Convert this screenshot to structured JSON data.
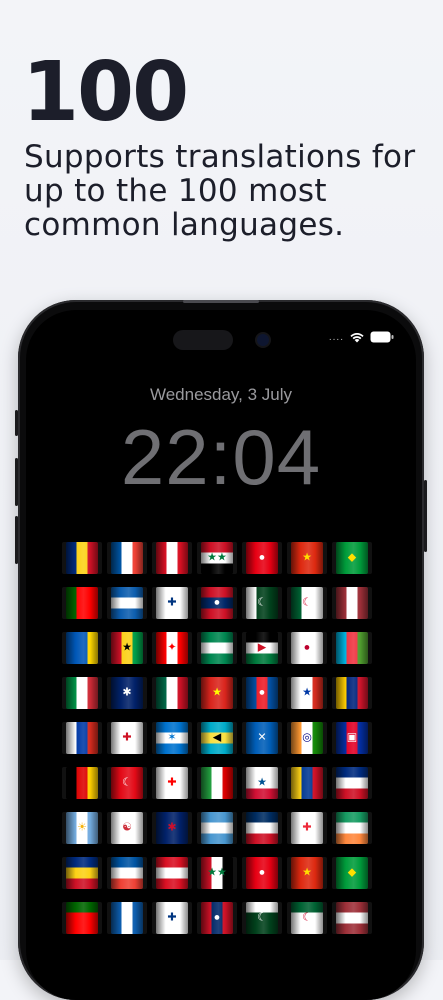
{
  "headline": "100",
  "subline": "Supports translations for up to the 100 most common languages.",
  "lockscreen": {
    "date": "Wednesday, 3 July",
    "time": "22:04",
    "status_dots": "....",
    "icons": [
      "wifi-icon",
      "battery-icon"
    ]
  },
  "flags": [
    {
      "name": "flag-romania",
      "colors": [
        "#002b7f",
        "#fcd116",
        "#ce1126"
      ],
      "dir": "v"
    },
    {
      "name": "flag-france",
      "colors": [
        "#0055a4",
        "#ffffff",
        "#ef4135"
      ],
      "dir": "v"
    },
    {
      "name": "flag-peru",
      "colors": [
        "#d91023",
        "#ffffff",
        "#d91023"
      ],
      "dir": "v"
    },
    {
      "name": "flag-syria",
      "colors": [
        "#ce1126",
        "#ffffff",
        "#000000"
      ],
      "dir": "h",
      "emb": "★★",
      "embColor": "#007a3d"
    },
    {
      "name": "flag-tunisia",
      "colors": [
        "#e70013",
        "#e70013",
        "#e70013"
      ],
      "dir": "h",
      "emb": "●",
      "embColor": "#ffffff"
    },
    {
      "name": "flag-china",
      "colors": [
        "#de2910",
        "#de2910",
        "#de2910"
      ],
      "dir": "h",
      "emb": "★",
      "embColor": "#ffde00"
    },
    {
      "name": "flag-brazil",
      "colors": [
        "#009c3b",
        "#009c3b",
        "#009c3b"
      ],
      "dir": "h",
      "emb": "◆",
      "embColor": "#ffdf00"
    },
    {
      "name": "flag-portugal",
      "colors": [
        "#006600",
        "#ff0000",
        "#ff0000"
      ],
      "dir": "v"
    },
    {
      "name": "flag-greece",
      "colors": [
        "#0d5eaf",
        "#ffffff",
        "#0d5eaf"
      ],
      "dir": "h",
      "emb": "✚",
      "embColor": "#ffffff"
    },
    {
      "name": "flag-finland",
      "colors": [
        "#ffffff",
        "#ffffff",
        "#ffffff"
      ],
      "dir": "h",
      "emb": "✚",
      "embColor": "#003580"
    },
    {
      "name": "flag-laos",
      "colors": [
        "#ce1126",
        "#002868",
        "#ce1126"
      ],
      "dir": "h",
      "emb": "●",
      "embColor": "#ffffff"
    },
    {
      "name": "flag-pakistan",
      "colors": [
        "#ffffff",
        "#01411c",
        "#01411c"
      ],
      "dir": "v",
      "emb": "☾",
      "embColor": "#ffffff"
    },
    {
      "name": "flag-algeria",
      "colors": [
        "#006233",
        "#ffffff",
        "#ffffff"
      ],
      "dir": "v",
      "emb": "☾",
      "embColor": "#d21034"
    },
    {
      "name": "flag-latvia",
      "colors": [
        "#9e3039",
        "#ffffff",
        "#9e3039"
      ],
      "dir": "v"
    },
    {
      "name": "flag-ukraine",
      "colors": [
        "#0057b7",
        "#0057b7",
        "#ffd700"
      ],
      "dir": "v"
    },
    {
      "name": "flag-guinea-bissau",
      "colors": [
        "#ce1126",
        "#fcd116",
        "#009e49"
      ],
      "dir": "v",
      "emb": "★",
      "embColor": "#000000"
    },
    {
      "name": "flag-canada",
      "colors": [
        "#ff0000",
        "#ffffff",
        "#ff0000"
      ],
      "dir": "v",
      "emb": "✦",
      "embColor": "#ff0000"
    },
    {
      "name": "flag-nigeria",
      "colors": [
        "#008751",
        "#ffffff",
        "#008751"
      ],
      "dir": "h"
    },
    {
      "name": "flag-jordan",
      "colors": [
        "#000000",
        "#ffffff",
        "#007a3d"
      ],
      "dir": "h",
      "emb": "▶",
      "embColor": "#ce1126"
    },
    {
      "name": "flag-japan",
      "colors": [
        "#ffffff",
        "#ffffff",
        "#ffffff"
      ],
      "dir": "h",
      "emb": "●",
      "embColor": "#bc002d"
    },
    {
      "name": "flag-azerbaijan",
      "colors": [
        "#00b5e2",
        "#ef3340",
        "#509e2f"
      ],
      "dir": "v"
    },
    {
      "name": "flag-italy",
      "colors": [
        "#009246",
        "#ffffff",
        "#ce2b37"
      ],
      "dir": "v"
    },
    {
      "name": "flag-australia",
      "colors": [
        "#012169",
        "#012169",
        "#012169"
      ],
      "dir": "h",
      "emb": "✱",
      "embColor": "#ffffff"
    },
    {
      "name": "flag-mexico",
      "colors": [
        "#006847",
        "#ffffff",
        "#ce1126"
      ],
      "dir": "v"
    },
    {
      "name": "flag-vietnam",
      "colors": [
        "#da251d",
        "#da251d",
        "#da251d"
      ],
      "dir": "h",
      "emb": "★",
      "embColor": "#ffff00"
    },
    {
      "name": "flag-north-korea",
      "colors": [
        "#024fa2",
        "#ed1c27",
        "#024fa2"
      ],
      "dir": "v",
      "emb": "●",
      "embColor": "#ffffff"
    },
    {
      "name": "flag-chile",
      "colors": [
        "#ffffff",
        "#ffffff",
        "#d52b1e"
      ],
      "dir": "v",
      "emb": "★",
      "embColor": "#0039a6"
    },
    {
      "name": "flag-venezuela",
      "colors": [
        "#ffcc00",
        "#00247d",
        "#cf142b"
      ],
      "dir": "v"
    },
    {
      "name": "flag-russia",
      "colors": [
        "#ffffff",
        "#0039a6",
        "#d52b1e"
      ],
      "dir": "v"
    },
    {
      "name": "flag-england",
      "colors": [
        "#ffffff",
        "#ffffff",
        "#ffffff"
      ],
      "dir": "h",
      "emb": "✚",
      "embColor": "#ce1124"
    },
    {
      "name": "flag-honduras",
      "colors": [
        "#0073cf",
        "#ffffff",
        "#0073cf"
      ],
      "dir": "h",
      "emb": "✶",
      "embColor": "#0073cf"
    },
    {
      "name": "flag-bahamas",
      "colors": [
        "#00abc9",
        "#fae042",
        "#00abc9"
      ],
      "dir": "h",
      "emb": "◀",
      "embColor": "#000000"
    },
    {
      "name": "flag-scotland",
      "colors": [
        "#005eb8",
        "#005eb8",
        "#005eb8"
      ],
      "dir": "h",
      "emb": "✕",
      "embColor": "#ffffff"
    },
    {
      "name": "flag-india",
      "colors": [
        "#ff9933",
        "#ffffff",
        "#138808"
      ],
      "dir": "v",
      "emb": "◎",
      "embColor": "#000080"
    },
    {
      "name": "flag-cambodia",
      "colors": [
        "#032ea1",
        "#e00025",
        "#032ea1"
      ],
      "dir": "v",
      "emb": "▣",
      "embColor": "#ffffff"
    },
    {
      "name": "flag-germany",
      "colors": [
        "#000000",
        "#dd0000",
        "#ffce00"
      ],
      "dir": "v"
    },
    {
      "name": "flag-turkey",
      "colors": [
        "#e30a17",
        "#e30a17",
        "#e30a17"
      ],
      "dir": "h",
      "emb": "☾",
      "embColor": "#ffffff"
    },
    {
      "name": "flag-georgia",
      "colors": [
        "#ffffff",
        "#ffffff",
        "#ffffff"
      ],
      "dir": "h",
      "emb": "✚",
      "embColor": "#ff0000"
    },
    {
      "name": "flag-iran",
      "colors": [
        "#239f40",
        "#ffffff",
        "#da0000"
      ],
      "dir": "v"
    },
    {
      "name": "flag-panama",
      "colors": [
        "#ffffff",
        "#ffffff",
        "#d21034"
      ],
      "dir": "h",
      "emb": "★",
      "embColor": "#005293"
    },
    {
      "name": "flag-colombia",
      "colors": [
        "#fcd116",
        "#003893",
        "#ce1126"
      ],
      "dir": "v"
    },
    {
      "name": "flag-costa-rica",
      "colors": [
        "#002b7f",
        "#ffffff",
        "#ce1126"
      ],
      "dir": "h"
    },
    {
      "name": "flag-argentina",
      "colors": [
        "#74acdf",
        "#ffffff",
        "#74acdf"
      ],
      "dir": "v",
      "emb": "☀",
      "embColor": "#f6b40e"
    },
    {
      "name": "flag-south-korea",
      "colors": [
        "#ffffff",
        "#ffffff",
        "#ffffff"
      ],
      "dir": "h",
      "emb": "☯",
      "embColor": "#cd2e3a"
    },
    {
      "name": "flag-new-zealand",
      "colors": [
        "#012169",
        "#012169",
        "#012169"
      ],
      "dir": "h",
      "emb": "✱",
      "embColor": "#c8102e"
    },
    {
      "name": "flag-guatemala",
      "colors": [
        "#4997d0",
        "#ffffff",
        "#4997d0"
      ],
      "dir": "h"
    },
    {
      "name": "flag-dominican-republic",
      "colors": [
        "#002d62",
        "#ffffff",
        "#ce1126"
      ],
      "dir": "h",
      "emb": "✚",
      "embColor": "#ffffff"
    },
    {
      "name": "flag-faroe-islands",
      "colors": [
        "#ffffff",
        "#ffffff",
        "#ffffff"
      ],
      "dir": "h",
      "emb": "✚",
      "embColor": "#ed2939"
    },
    {
      "name": "flag-ireland",
      "colors": [
        "#169b62",
        "#ffffff",
        "#ff883e"
      ],
      "dir": "h"
    },
    {
      "name": "flag-romania-2",
      "colors": [
        "#002b7f",
        "#fcd116",
        "#ce1126"
      ],
      "dir": "h"
    },
    {
      "name": "flag-france-2",
      "colors": [
        "#0055a4",
        "#ffffff",
        "#ef4135"
      ],
      "dir": "h"
    },
    {
      "name": "flag-peru-2",
      "colors": [
        "#d91023",
        "#ffffff",
        "#d91023"
      ],
      "dir": "h"
    },
    {
      "name": "flag-syria-2",
      "colors": [
        "#ce1126",
        "#ffffff",
        "#000000"
      ],
      "dir": "v",
      "emb": "★★",
      "embColor": "#007a3d"
    },
    {
      "name": "flag-tunisia-2",
      "colors": [
        "#e70013",
        "#e70013",
        "#e70013"
      ],
      "dir": "v",
      "emb": "●",
      "embColor": "#ffffff"
    },
    {
      "name": "flag-china-2",
      "colors": [
        "#de2910",
        "#de2910",
        "#de2910"
      ],
      "dir": "v",
      "emb": "★",
      "embColor": "#ffde00"
    },
    {
      "name": "flag-brazil-2",
      "colors": [
        "#009c3b",
        "#009c3b",
        "#009c3b"
      ],
      "dir": "v",
      "emb": "◆",
      "embColor": "#ffdf00"
    },
    {
      "name": "flag-portugal-2",
      "colors": [
        "#006600",
        "#ff0000",
        "#ff0000"
      ],
      "dir": "h"
    },
    {
      "name": "flag-greece-2",
      "colors": [
        "#0d5eaf",
        "#ffffff",
        "#0d5eaf"
      ],
      "dir": "v",
      "emb": "✚",
      "embColor": "#ffffff"
    },
    {
      "name": "flag-finland-2",
      "colors": [
        "#ffffff",
        "#ffffff",
        "#ffffff"
      ],
      "dir": "v",
      "emb": "✚",
      "embColor": "#003580"
    },
    {
      "name": "flag-laos-2",
      "colors": [
        "#ce1126",
        "#002868",
        "#ce1126"
      ],
      "dir": "v",
      "emb": "●",
      "embColor": "#ffffff"
    },
    {
      "name": "flag-pakistan-2",
      "colors": [
        "#ffffff",
        "#01411c",
        "#01411c"
      ],
      "dir": "h",
      "emb": "☾",
      "embColor": "#ffffff"
    },
    {
      "name": "flag-algeria-2",
      "colors": [
        "#006233",
        "#ffffff",
        "#ffffff"
      ],
      "dir": "h",
      "emb": "☾",
      "embColor": "#d21034"
    },
    {
      "name": "flag-latvia-2",
      "colors": [
        "#9e3039",
        "#ffffff",
        "#9e3039"
      ],
      "dir": "h"
    }
  ]
}
